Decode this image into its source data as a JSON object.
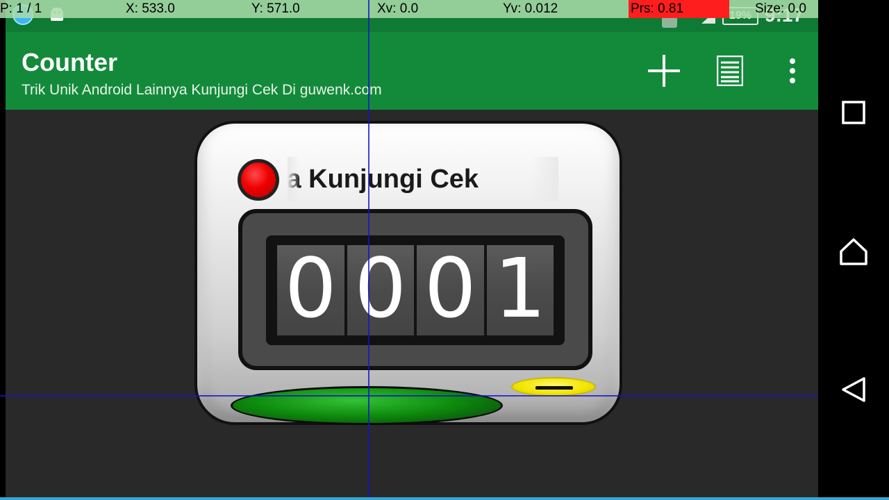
{
  "status_bar": {
    "battery": "19%",
    "clock": "9:17",
    "icons": [
      "app-notification-icon",
      "android-icon",
      "sim-icon",
      "signal-icon",
      "battery-icon"
    ]
  },
  "action_bar": {
    "title": "Counter",
    "subtitle": "Trik Unik Android Lainnya Kunjungi Cek Di guwenk.com",
    "actions": [
      "add-icon",
      "list-icon",
      "more-vert-icon"
    ],
    "color": "#138a3a"
  },
  "counter": {
    "marquee_text": "Lainnya Kunjungi Cek",
    "digits": [
      "0",
      "0",
      "0",
      "1"
    ],
    "indicator_color": "#ee0000",
    "count_button_color": "#0d8a0d",
    "reset_button_color": "#f2e400"
  },
  "pointer_overlay": {
    "p": "P: 1 / 1",
    "x": "X: 533.0",
    "y": "Y: 571.0",
    "xv": "Xv: 0.0",
    "yv": "Yv: 0.012",
    "prs": "Prs: 0.81",
    "size": "Size: 0.0"
  },
  "nav_bar": {
    "buttons": [
      "recents-icon",
      "home-icon",
      "back-icon"
    ]
  }
}
